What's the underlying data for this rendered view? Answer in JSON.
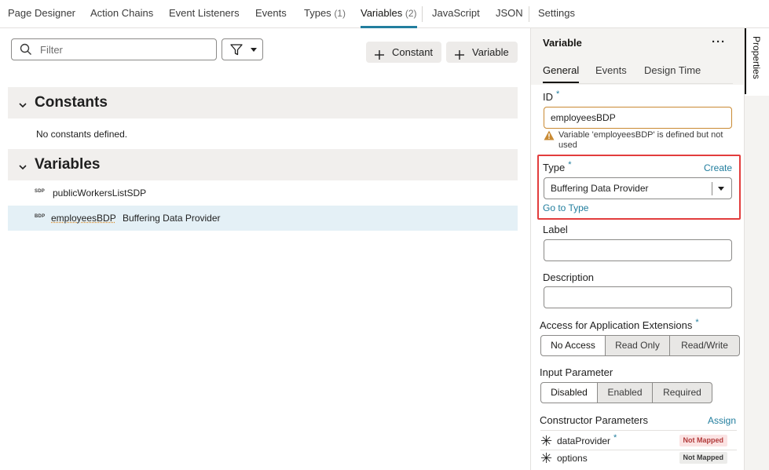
{
  "tabs": [
    {
      "label": "Page Designer",
      "count": ""
    },
    {
      "label": "Action Chains",
      "count": ""
    },
    {
      "label": "Event Listeners",
      "count": ""
    },
    {
      "label": "Events",
      "count": ""
    },
    {
      "label": "Types",
      "count": "(1)"
    },
    {
      "label": "Variables",
      "count": "(2)"
    },
    {
      "label": "JavaScript",
      "count": ""
    },
    {
      "label": "JSON",
      "count": ""
    },
    {
      "label": "Settings",
      "count": ""
    }
  ],
  "toolbar": {
    "filter_placeholder": "Filter",
    "constant_label": "Constant",
    "variable_label": "Variable"
  },
  "constants_section": {
    "title": "Constants",
    "empty_text": "No constants defined."
  },
  "variables_section": {
    "title": "Variables",
    "items": [
      {
        "abbr": "SDP",
        "name": "publicWorkersListSDP",
        "type": ""
      },
      {
        "abbr": "BDP",
        "name": "employeesBDP",
        "type": "Buffering Data Provider"
      }
    ]
  },
  "properties": {
    "header": "Variable",
    "more": "···",
    "tabs": [
      "General",
      "Events",
      "Design Time"
    ],
    "id_label": "ID",
    "id_value": "employeesBDP",
    "warning": "Variable 'employeesBDP' is defined but not used",
    "type_label": "Type",
    "create_link": "Create",
    "type_value": "Buffering Data Provider",
    "go_to_type": "Go to Type",
    "label_label": "Label",
    "description_label": "Description",
    "access_label": "Access for Application Extensions",
    "access_options": [
      "No Access",
      "Read Only",
      "Read/Write"
    ],
    "access_selected": "No Access",
    "input_param_label": "Input Parameter",
    "input_param_options": [
      "Disabled",
      "Enabled",
      "Required"
    ],
    "input_param_selected": "Disabled",
    "constructor_label": "Constructor Parameters",
    "assign_link": "Assign",
    "params": [
      {
        "name": "dataProvider",
        "required": true,
        "status": "Not Mapped"
      },
      {
        "name": "options",
        "required": false,
        "status": "Not Mapped"
      }
    ],
    "required_mark": "*"
  },
  "side_tab": "Properties",
  "colors": {
    "accent": "#227e9e",
    "highlight": "#e23d3d",
    "selected_row": "#e4f0f6",
    "warning": "#c98a33"
  }
}
